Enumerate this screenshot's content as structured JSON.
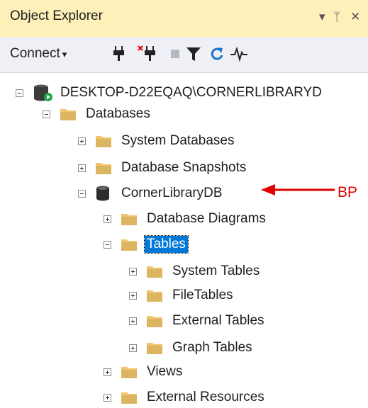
{
  "panel": {
    "title": "Object Explorer",
    "pin_glyph": "ᛘ",
    "close_glyph": "✕",
    "dropdown_glyph": "▾"
  },
  "toolbar": {
    "connect_label": "Connect",
    "connect_caret": "▾",
    "tools": [
      "connect-icon",
      "disconnect-icon",
      "stop-icon",
      "filter-icon",
      "refresh-icon",
      "activity-monitor-icon"
    ]
  },
  "tree": {
    "server": "DESKTOP-D22EQAQ\\CORNERLIBRARYD",
    "databases": "Databases",
    "system_databases": "System Databases",
    "database_snapshots": "Database Snapshots",
    "db": "CornerLibraryDB",
    "database_diagrams": "Database Diagrams",
    "tables": "Tables",
    "system_tables": "System Tables",
    "file_tables": "FileTables",
    "external_tables": "External Tables",
    "graph_tables": "Graph Tables",
    "views": "Views",
    "external_resources": "External Resources"
  },
  "annotation": {
    "text": "BP",
    "color": "#e00000"
  },
  "colors": {
    "title_bar": "#ffefb8",
    "toolbar": "#eef0f6",
    "selection": "#0078d7",
    "folder": "#f2c36b"
  }
}
